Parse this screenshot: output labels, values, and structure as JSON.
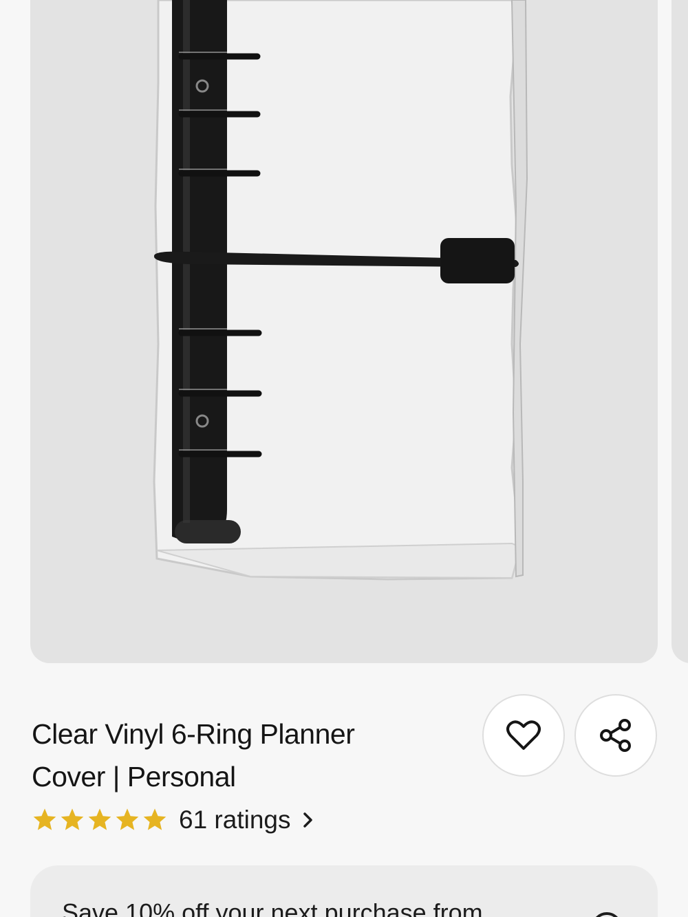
{
  "product": {
    "title_line1": "Clear Vinyl 6-Ring Planner",
    "title_line2": "Cover | Personal",
    "rating": {
      "stars": 5,
      "count_text": "61 ratings"
    }
  },
  "actions": {
    "favorite_icon": "heart-icon",
    "share_icon": "share-icon"
  },
  "promo": {
    "text": "Save 10% off your next purchase from"
  },
  "colors": {
    "star": "#e6b422",
    "background": "#f7f7f7",
    "image_bg": "#e3e3e3"
  }
}
